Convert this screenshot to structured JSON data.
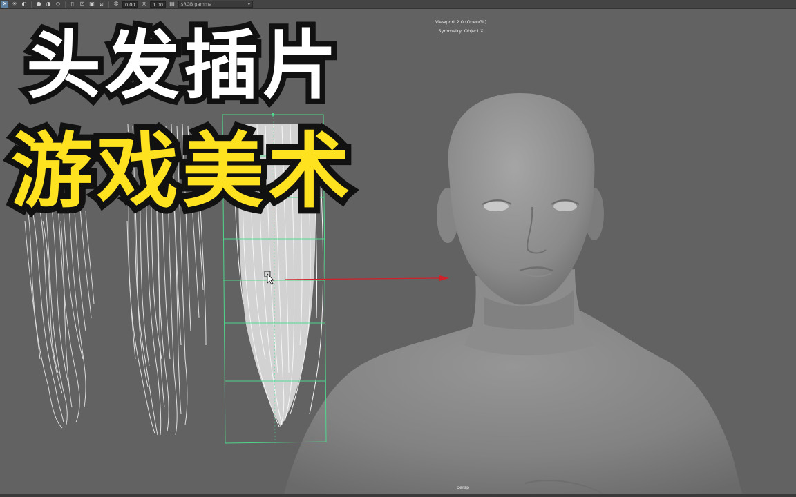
{
  "toolbar": {
    "field_1": "0.00",
    "field_2": "1.00",
    "color_space": "sRGB gamma",
    "icons": [
      "select-icon",
      "light-icon",
      "shade-icon",
      "texture-icon",
      "wire-icon",
      "isolate-icon",
      "xray-icon",
      "grid-icon",
      "camera-icon",
      "exposure-icon",
      "gamma-icon",
      "color-management-icon"
    ]
  },
  "viewport": {
    "renderer": "Viewport 2.0 (OpenGL)",
    "symmetry": "Symmetry: Object X",
    "camera": "persp"
  },
  "overlay": {
    "line1": "头发插片",
    "line2": "游戏美术",
    "line1_color": "#ffffff",
    "line2_color": "#ffe21f",
    "outline_color": "#111111"
  },
  "scene": {
    "hair_cards": [
      "hair-card-left",
      "hair-card-middle",
      "hair-card-selected"
    ],
    "selection_color": "#4fdc8e",
    "manipulator_color": "#d0202a",
    "model": "head-bust-model"
  }
}
